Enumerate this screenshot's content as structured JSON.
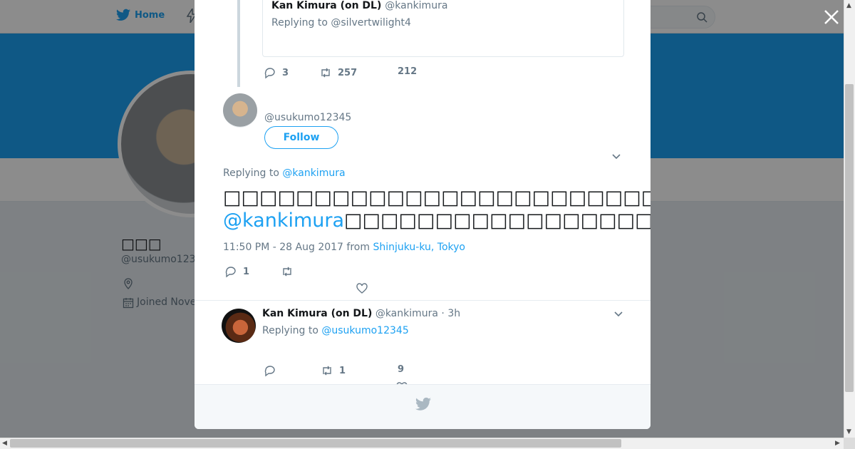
{
  "nav": {
    "home_label": "Home"
  },
  "profile": {
    "name": "□□□",
    "handle": "@usukumo123",
    "joined": "Joined Nove"
  },
  "quoted": {
    "name": "Kan Kimura (on DL)",
    "handle": "@kankimura",
    "replying_prefix": "Replying to ",
    "replying_to": "@silvertwilight4",
    "replies": "3",
    "retweets": "257",
    "likes": "212"
  },
  "main_tweet": {
    "handle": "@usukumo12345",
    "follow_label": "Follow",
    "replying_prefix": "Replying to ",
    "replying_to": "@kankimura",
    "text_line1": "□□□□□□□□□□□□□□□□□□□□□□□□□□□□□□□□□□□□□□□□□□□□□□□□□□□□□□□",
    "text_mention": "@kankimura",
    "text_line2": "□□□□□□□□□□□□□□□□□□□□□□□□□□□□□□□□□□□□□□□□□□□□□□□□□□□□□",
    "timestamp": "11:50 PM - 28 Aug 2017 from ",
    "location": "Shinjuku-ku, Tokyo",
    "replies": "1"
  },
  "reply": {
    "name": "Kan Kimura (on DL)",
    "meta": " @kankimura · 3h",
    "replying_prefix": "Replying to ",
    "replying_to": "@usukumo12345",
    "retweets": "1",
    "likes": "9"
  },
  "colors": {
    "accent": "#1da1f2",
    "banner": "#1da1f2",
    "muted": "#657786"
  },
  "icons": [
    "twitter-bird-icon",
    "search-icon",
    "close-icon",
    "reply-icon",
    "retweet-icon",
    "heart-icon",
    "chevron-down-icon",
    "location-icon",
    "calendar-icon"
  ]
}
